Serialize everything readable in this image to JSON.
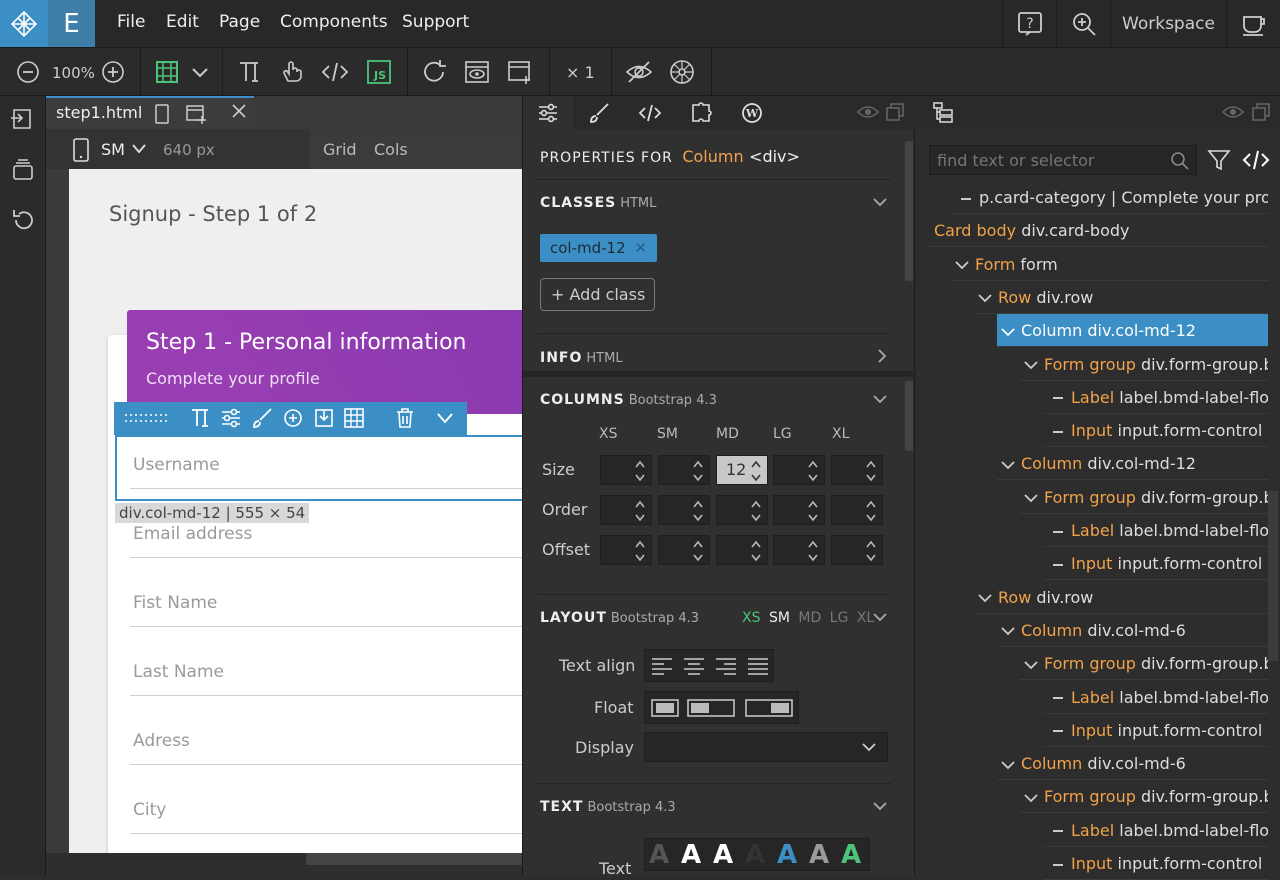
{
  "menubar": {
    "items": [
      "File",
      "Edit",
      "Page",
      "Components",
      "Support"
    ],
    "logo_letter": "E",
    "workspace": "Workspace"
  },
  "toolbar": {
    "zoom": "100%",
    "multiplier": "× 1"
  },
  "doc": {
    "tab_name": "step1.html",
    "breakpoint": "SM",
    "width": "640 px",
    "grid": "Grid",
    "cols": "Cols",
    "page_title": "Signup - Step 1 of 2",
    "card_title": "Step 1 - Personal information",
    "card_subtitle": "Complete your profile",
    "selection_label": "div.col-md-12 | 555 × 54",
    "fields": [
      "Username",
      "Email address",
      "Fist Name",
      "Last Name",
      "Adress",
      "City"
    ]
  },
  "props": {
    "properties_for": "PROPERTIES FOR",
    "element_name": "Column",
    "element_tag": "<div>",
    "classes_title": "CLASSES",
    "classes_sub": "HTML",
    "class_chip": "col-md-12",
    "add_class": "Add class",
    "info_title": "INFO",
    "info_sub": "HTML",
    "columns_title": "COLUMNS",
    "columns_sub": "Bootstrap 4.3",
    "breakpoints": [
      "XS",
      "SM",
      "MD",
      "LG",
      "XL"
    ],
    "row_size": "Size",
    "row_order": "Order",
    "row_offset": "Offset",
    "size_md_value": "12",
    "layout_title": "LAYOUT",
    "layout_sub": "Bootstrap 4.3",
    "layout_bps": [
      "XS",
      "SM",
      "MD",
      "LG",
      "XL"
    ],
    "text_align": "Text align",
    "float": "Float",
    "display": "Display",
    "text_title": "TEXT",
    "text_sub": "Bootstrap 4.3",
    "text_label": "Text",
    "text_swatch_letter": "A"
  },
  "tree": {
    "search_placeholder": "find text or selector",
    "nodes": [
      {
        "k": "",
        "v": "p.card-category | Complete your profil..."
      },
      {
        "k": "Card body",
        "v": "div.card-body"
      },
      {
        "k": "Form",
        "v": "form"
      },
      {
        "k": "Row",
        "v": "div.row"
      },
      {
        "k": "Column",
        "v": "div.col-md-12"
      },
      {
        "k": "Form group",
        "v": "div.form-group.bm"
      },
      {
        "k": "Label",
        "v": "label.bmd-label-floatir"
      },
      {
        "k": "Input",
        "v": "input.form-control"
      },
      {
        "k": "Column",
        "v": "div.col-md-12"
      },
      {
        "k": "Form group",
        "v": "div.form-group.bm"
      },
      {
        "k": "Label",
        "v": "label.bmd-label-floatir"
      },
      {
        "k": "Input",
        "v": "input.form-control"
      },
      {
        "k": "Row",
        "v": "div.row"
      },
      {
        "k": "Column",
        "v": "div.col-md-6"
      },
      {
        "k": "Form group",
        "v": "div.form-group.bm"
      },
      {
        "k": "Label",
        "v": "label.bmd-label-floatir"
      },
      {
        "k": "Input",
        "v": "input.form-control"
      },
      {
        "k": "Column",
        "v": "div.col-md-6"
      },
      {
        "k": "Form group",
        "v": "div.form-group.bm"
      },
      {
        "k": "Label",
        "v": "label.bmd-label-floatir"
      },
      {
        "k": "Input",
        "v": "input.form-control"
      }
    ]
  },
  "colors": {
    "accent": "#3b8fc4",
    "orange": "#f0a24a",
    "green": "#4cc47a",
    "purple": "#9b3fb2"
  }
}
